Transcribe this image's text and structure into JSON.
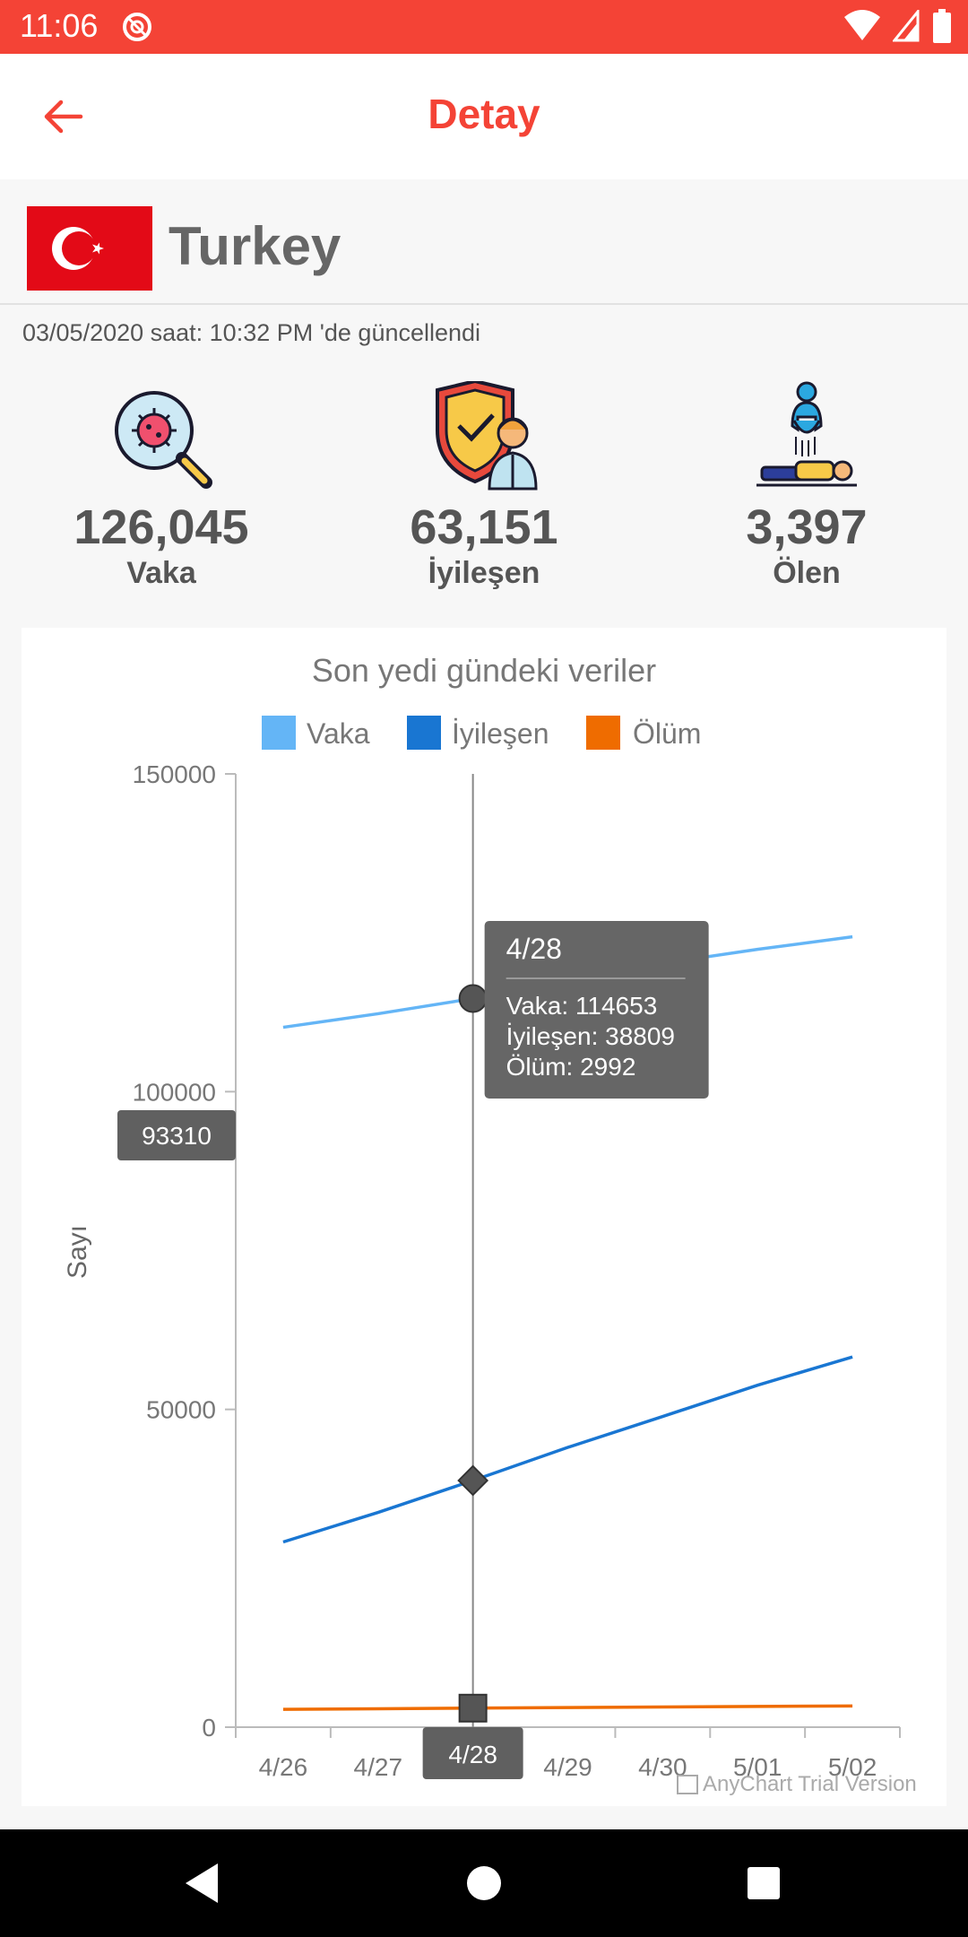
{
  "status_bar": {
    "time": "11:06"
  },
  "app_bar": {
    "title": "Detay"
  },
  "country": {
    "name": "Turkey"
  },
  "updated": "03/05/2020 saat: 10:32 PM 'de güncellendi",
  "stats": {
    "cases": {
      "value": "126,045",
      "label": "Vaka",
      "icon": "virus-magnifier-icon"
    },
    "recovered": {
      "value": "63,151",
      "label": "İyileşen",
      "icon": "shield-doctor-icon"
    },
    "deaths": {
      "value": "3,397",
      "label": "Ölen",
      "icon": "deceased-person-icon"
    }
  },
  "colors": {
    "accent": "#f44336",
    "vaka": "#64b5f6",
    "iyilesen": "#1976d2",
    "olum": "#ef6c00"
  },
  "chart_data": {
    "type": "line",
    "title": "Son yedi gündeki veriler",
    "ylabel": "Sayı",
    "xlabel": "",
    "categories": [
      "4/26",
      "4/27",
      "4/28",
      "4/29",
      "4/30",
      "5/01",
      "5/02"
    ],
    "ylim": [
      0,
      150000
    ],
    "yticks": [
      "150000",
      "100000",
      "50000",
      "0"
    ],
    "legend_position": "top",
    "series": [
      {
        "name": "Vaka",
        "color": "#64b5f6",
        "values": [
          110130,
          112261,
          114653,
          117589,
          120204,
          122392,
          124375
        ]
      },
      {
        "name": "İyileşen",
        "color": "#1976d2",
        "values": [
          29140,
          33791,
          38809,
          44022,
          48886,
          53808,
          58259
        ]
      },
      {
        "name": "Ölüm",
        "color": "#ef6c00",
        "values": [
          2805,
          2900,
          2992,
          3081,
          3174,
          3258,
          3336
        ]
      }
    ],
    "tooltip": {
      "title": "4/28",
      "lines": [
        "Vaka: 114653",
        "İyileşen: 38809",
        "Ölüm: 2992"
      ]
    },
    "crosshair_y_label": "93310",
    "crosshair_x_label": "4/28",
    "watermark": "AnyChart Trial Version"
  }
}
